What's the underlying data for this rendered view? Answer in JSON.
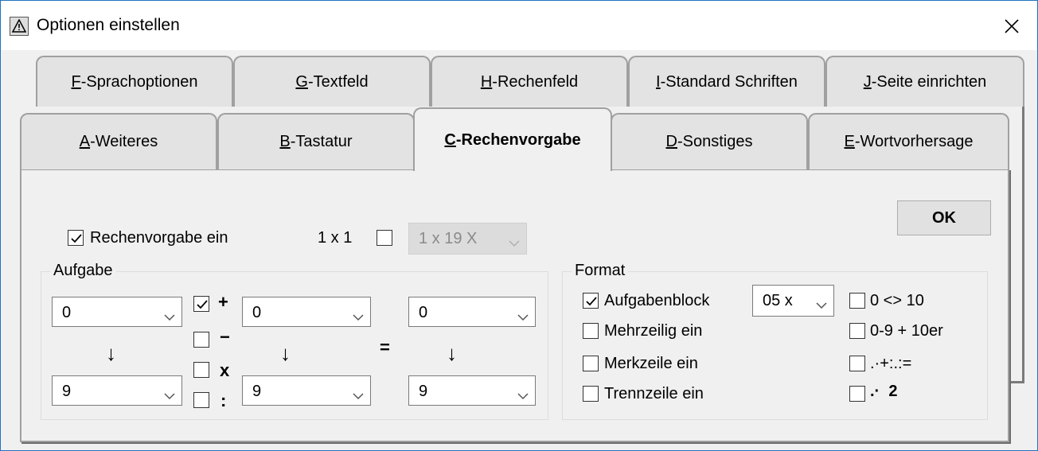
{
  "window": {
    "title": "Optionen einstellen"
  },
  "tabs_back": [
    {
      "key": "F",
      "rest": "-Sprachoptionen"
    },
    {
      "key": "G",
      "rest": "-Textfeld"
    },
    {
      "key": "H",
      "rest": "-Rechenfeld"
    },
    {
      "key": "I",
      "rest": "-Standard Schriften"
    },
    {
      "key": "J",
      "rest": "-Seite einrichten"
    }
  ],
  "tabs_front": [
    {
      "key": "A",
      "rest": "-Weiteres"
    },
    {
      "key": "B",
      "rest": "-Tastatur"
    },
    {
      "key": "C",
      "rest": "-Rechenvorgabe"
    },
    {
      "key": "D",
      "rest": "-Sonstiges"
    },
    {
      "key": "E",
      "rest": "-Wortvorhersage"
    }
  ],
  "ok_label": "OK",
  "rechenvorgabe": {
    "label": "Rechenvorgabe ein",
    "checked": true
  },
  "einmaleins": {
    "label": "1 x 1",
    "checked": false,
    "combo_value": "1 x 19 X"
  },
  "aufgabe": {
    "title": "Aufgabe",
    "combo1_from": "0",
    "combo1_to": "9",
    "combo2_from": "0",
    "combo2_to": "9",
    "combo3_from": "0",
    "combo3_to": "9",
    "ops": [
      {
        "symbol": "+",
        "checked": true
      },
      {
        "symbol": "−",
        "checked": false
      },
      {
        "symbol": "x",
        "checked": false
      },
      {
        "symbol": ":",
        "checked": false
      }
    ],
    "arrow": "↓",
    "equals": "="
  },
  "format": {
    "title": "Format",
    "aufgabenblock": {
      "label": "Aufgabenblock",
      "checked": true,
      "combo_value": "05 x"
    },
    "mehrzeilig": {
      "label": "Mehrzeilig ein",
      "checked": false
    },
    "merkzeile": {
      "label": "Merkzeile ein",
      "checked": false
    },
    "trennzeile": {
      "label": "Trennzeile ein",
      "checked": false
    },
    "right": [
      {
        "label": "0 <> 10",
        "checked": false
      },
      {
        "label": "0-9 + 10er",
        "checked": false
      },
      {
        "label": ".·+:.:=",
        "checked": false
      },
      {
        "label": ".·  2",
        "checked": false
      }
    ]
  }
}
